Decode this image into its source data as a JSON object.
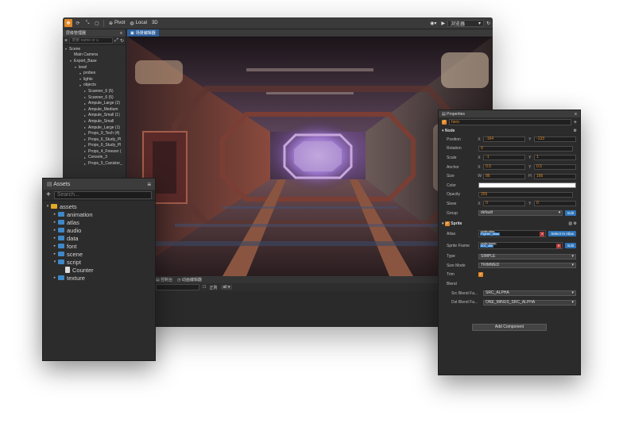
{
  "editor": {
    "toolbar": {
      "pivot_label": "Pivot",
      "local_label": "Local",
      "mode_3d_label": "3D",
      "platform_label": "浏览器",
      "refresh_label": "C"
    },
    "hierarchy": {
      "tab_label": "层级管理器",
      "search_placeholder": "搜索 name or u",
      "items": [
        {
          "label": "Scene",
          "depth": 0
        },
        {
          "label": "Main Camera",
          "depth": 1
        },
        {
          "label": "Export_Base",
          "depth": 1
        },
        {
          "label": "level",
          "depth": 2
        },
        {
          "label": "probes",
          "depth": 3
        },
        {
          "label": "lights",
          "depth": 3
        },
        {
          "label": "objects",
          "depth": 3
        },
        {
          "label": "Scanner_6 (5)",
          "depth": 4
        },
        {
          "label": "Scanner_6 (5)",
          "depth": 4
        },
        {
          "label": "Ampule_Large (2)",
          "depth": 4
        },
        {
          "label": "Ampule_Medium",
          "depth": 4
        },
        {
          "label": "Ampule_Small (1)",
          "depth": 4
        },
        {
          "label": "Ampule_Small",
          "depth": 4
        },
        {
          "label": "Ampule_Large (1)",
          "depth": 4
        },
        {
          "label": "Props_9_Tech (4)",
          "depth": 4
        },
        {
          "label": "Props_6_Study_Pl",
          "depth": 4
        },
        {
          "label": "Props_6_Study_Pl",
          "depth": 4
        },
        {
          "label": "Props_4_Freezer (",
          "depth": 4
        },
        {
          "label": "Console_3",
          "depth": 4
        },
        {
          "label": "Props_5_Canister_",
          "depth": 4
        }
      ]
    },
    "scene_tab": "场景编辑器",
    "bottom_tabs": {
      "console": "控制台",
      "animation": "动画编辑器"
    },
    "bottom_controls": {
      "log_label": "正则",
      "level_label": "all"
    }
  },
  "assets": {
    "title": "Assets",
    "search_placeholder": "Search...",
    "tree": [
      {
        "label": "assets",
        "kind": "root",
        "depth": 0,
        "expanded": true
      },
      {
        "label": "animation",
        "kind": "folder",
        "depth": 1
      },
      {
        "label": "atlas",
        "kind": "folder",
        "depth": 1
      },
      {
        "label": "audio",
        "kind": "folder",
        "depth": 1
      },
      {
        "label": "data",
        "kind": "folder",
        "depth": 1
      },
      {
        "label": "font",
        "kind": "folder",
        "depth": 1
      },
      {
        "label": "scene",
        "kind": "folder",
        "depth": 1
      },
      {
        "label": "script",
        "kind": "folder",
        "depth": 1,
        "expanded": true
      },
      {
        "label": "Counter",
        "kind": "file",
        "depth": 2
      },
      {
        "label": "texture",
        "kind": "folder",
        "depth": 1
      }
    ]
  },
  "properties": {
    "title": "Properties",
    "node_name": "hero",
    "node_section": "Node",
    "position": {
      "label": "Position",
      "x": "-164",
      "y": "-133"
    },
    "rotation": {
      "label": "Rotation",
      "value": "0"
    },
    "scale": {
      "label": "Scale",
      "x": "-1",
      "y": "1"
    },
    "anchor": {
      "label": "Anchor",
      "x": "0.5",
      "y": "0.5"
    },
    "size": {
      "label": "Size",
      "w": "86",
      "h": "166"
    },
    "color": {
      "label": "Color",
      "value": "#ffffff"
    },
    "opacity": {
      "label": "Opacity",
      "value": "255"
    },
    "skew": {
      "label": "Skew",
      "x": "0",
      "y": "0"
    },
    "group": {
      "label": "Group",
      "value": "default",
      "edit": "Edit"
    },
    "sprite_section": "Sprite",
    "atlas": {
      "label": "Atlas",
      "tag": "sprite-atlas",
      "value": "Fighter_atlas",
      "button": "Select In Atlas"
    },
    "sprite_frame": {
      "label": "Sprite Frame",
      "tag": "sprite-frame",
      "value": "001_idle",
      "button": "Edit"
    },
    "type": {
      "label": "Type",
      "value": "SIMPLE"
    },
    "size_mode": {
      "label": "Size Mode",
      "value": "TRIMMED"
    },
    "trim": {
      "label": "Trim"
    },
    "blend": {
      "label": "Blend"
    },
    "src_blend": {
      "label": "Src Blend Fa...",
      "value": "SRC_ALPHA"
    },
    "dst_blend": {
      "label": "Dst Blend Fa...",
      "value": "ONE_MINUS_SRC_ALPHA"
    },
    "add_component": "Add Component"
  }
}
